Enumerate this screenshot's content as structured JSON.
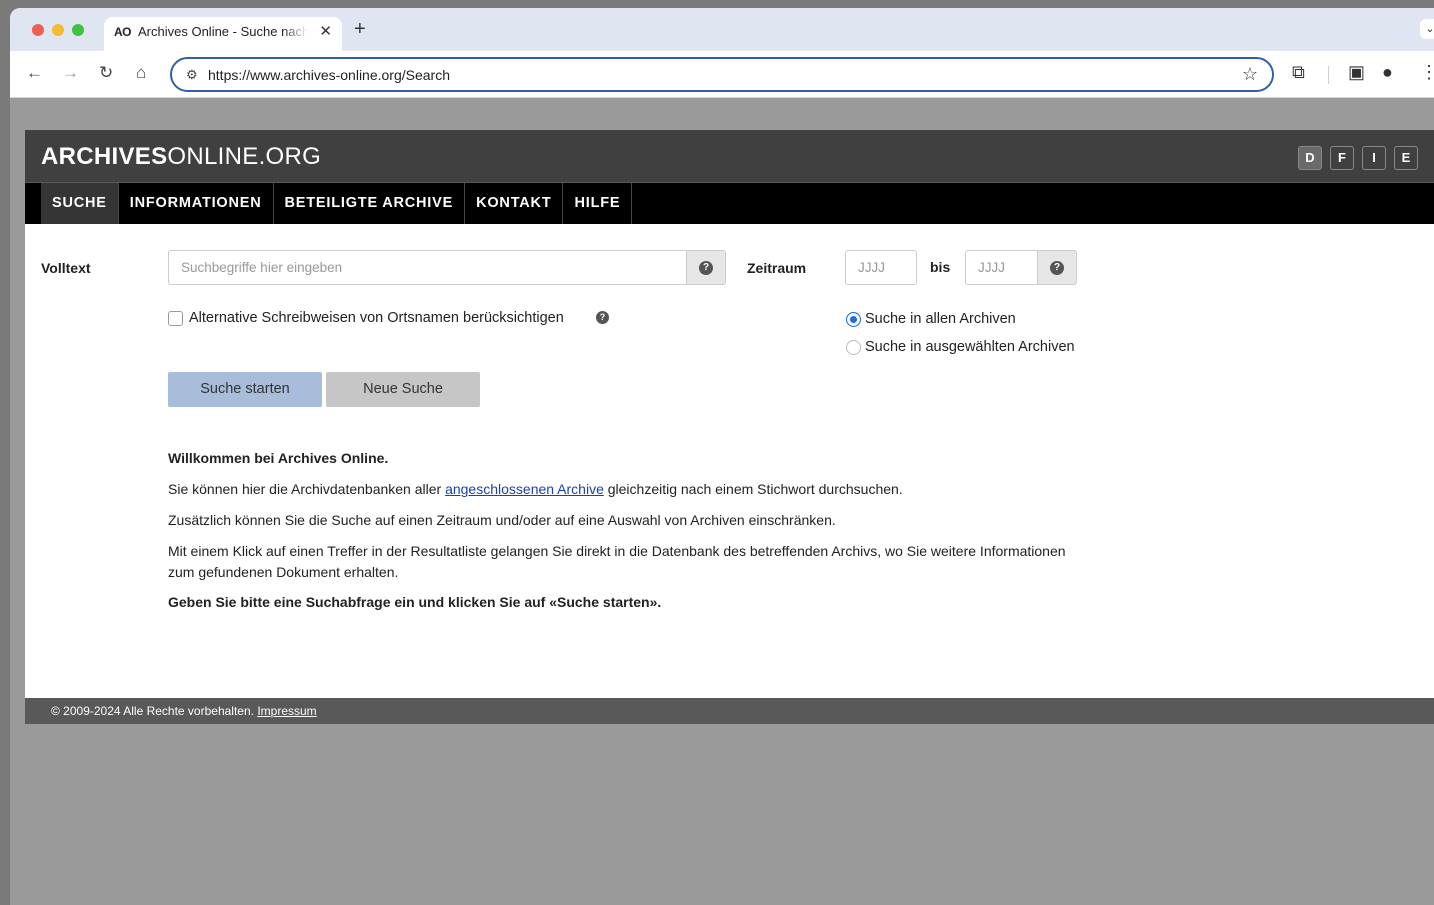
{
  "browser": {
    "tab_favicon": "AO",
    "tab_title": "Archives Online - Suche nach",
    "tab_close": "✕",
    "new_tab": "+",
    "url": "https://www.archives-online.org/Search"
  },
  "site": {
    "logo_bold": "ARCHIVES",
    "logo_rest": "ONLINE.ORG",
    "languages": [
      "D",
      "F",
      "I",
      "E"
    ],
    "active_language": "D",
    "nav": [
      "SUCHE",
      "INFORMATIONEN",
      "BETEILIGTE ARCHIVE",
      "KONTAKT",
      "HILFE"
    ]
  },
  "search": {
    "fulltext_label": "Volltext",
    "fulltext_placeholder": "Suchbegriffe hier eingeben",
    "period_label": "Zeitraum",
    "from_placeholder": "JJJJ",
    "bis_label": "bis",
    "to_placeholder": "JJJJ",
    "alt_spelling_label": "Alternative Schreibweisen von Ortsnamen berücksichtigen",
    "alt_spelling_checked": false,
    "radio_all": "Suche in allen Archiven",
    "radio_selected": "Suche in ausgewählten Archiven",
    "radio_value": "all",
    "start_button": "Suche starten",
    "new_button": "Neue Suche",
    "help_glyph": "?"
  },
  "content": {
    "welcome": "Willkommen bei Archives Online.",
    "line1_pre": "Sie können hier die Archivdatenbanken aller ",
    "line1_link": "angeschlossenen Archive",
    "line1_post": " gleichzeitig nach einem Stichwort durchsuchen.",
    "line2": "Zusätzlich können Sie die Suche auf einen Zeitraum und/oder auf eine Auswahl von Archiven einschränken.",
    "line3": "Mit einem Klick auf einen Treffer in der Resultatliste gelangen Sie direkt in die Datenbank des betreffenden Archivs, wo Sie weitere Informationen zum gefundenen Dokument erhalten.",
    "line4": "Geben Sie bitte eine Suchabfrage ein und klicken Sie auf «Suche starten»."
  },
  "footer": {
    "copyright": "© 2009-2024 Alle Rechte vorbehalten.",
    "impressum": "Impressum"
  },
  "colors": {
    "header_bg": "#404040",
    "nav_bg": "#000000",
    "primary_button": "#a8bdd9",
    "link": "#1a3fb5"
  }
}
